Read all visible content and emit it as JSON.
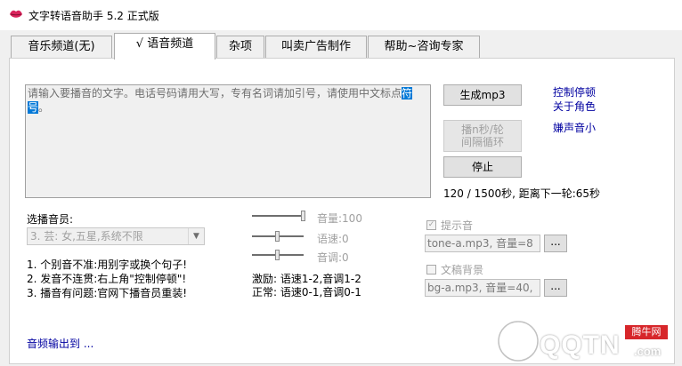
{
  "window": {
    "title": "文字转语音助手 5.2 正式版"
  },
  "tabs": [
    {
      "label": "音乐频道(无)"
    },
    {
      "label": "√ 语音频道"
    },
    {
      "label": "杂项"
    },
    {
      "label": "叫卖广告制作"
    },
    {
      "label": "帮助~咨询专家"
    }
  ],
  "editor": {
    "text_before": "请输入要播音的文字。电话号码请用大写，专有名词请加引号，请使用中文标点",
    "text_selected": "符号",
    "text_after": "。"
  },
  "buttons": {
    "generate_mp3": "生成mp3",
    "loop_play_line1": "播n秒/轮",
    "loop_play_line2": "间隔循环",
    "stop": "停止",
    "tone_browse": "...",
    "bg_browse": "..."
  },
  "links": {
    "control_pause": "控制停顿",
    "about_role": "关于角色",
    "noise_small": "嫌声音小",
    "audio_output": "音频输出到 ..."
  },
  "status": {
    "progress_text": "120 / 1500秒, 距离下一轮:65秒"
  },
  "voice": {
    "label": "选播音员:",
    "selected": "3. 芸: 女,五星,系统不限"
  },
  "tips": [
    "1. 个别音不准:用别字或换个句子!",
    "2. 发音不连贯:右上角\"控制停顿\"!",
    "3. 播音有问题:官网下播音员重装!"
  ],
  "sliders": {
    "volume": {
      "label": "音量:100",
      "value_fraction": 1.0
    },
    "speed": {
      "label": "语速:0",
      "value_fraction": 0.5
    },
    "pitch": {
      "label": "音调:0",
      "value_fraction": 0.5
    }
  },
  "presets": {
    "excited": "激励: 语速1-2,音调1-2",
    "normal": "正常: 语速0-1,音调0-1"
  },
  "tone": {
    "label": "提示音",
    "checked": true,
    "value": "tone-a.mp3, 音量=8"
  },
  "background": {
    "label": "文稿背景",
    "checked": false,
    "value": "bg-a.mp3, 音量=40,"
  },
  "watermark": {
    "brand": "QQTN",
    "suffix": ".com",
    "badge": "腾牛网"
  },
  "colors": {
    "link": "#0000a0",
    "selection": "#0078d7"
  }
}
